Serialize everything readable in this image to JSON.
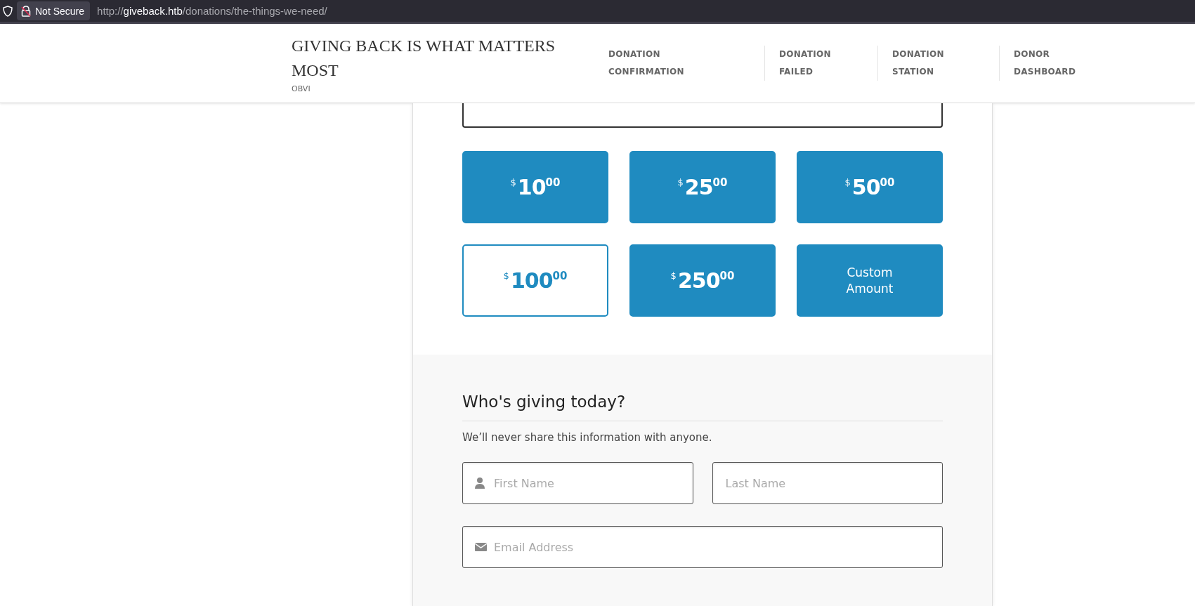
{
  "browser": {
    "security": "Not Secure",
    "url": {
      "scheme": "http://",
      "host": "giveback.htb",
      "path": "/donations/the-things-we-need/"
    }
  },
  "header": {
    "title": "GIVING BACK IS WHAT MATTERS MOST",
    "tagline": "OBVI",
    "nav": [
      {
        "label": "DONATION CONFIRMATION"
      },
      {
        "label": "DONATION FAILED"
      },
      {
        "label": "DONATION STATION"
      },
      {
        "label": "DONOR DASHBOARD"
      }
    ]
  },
  "amounts": [
    {
      "kind": "preset",
      "currency": "$",
      "whole": "10",
      "cents": "00",
      "selected": false
    },
    {
      "kind": "preset",
      "currency": "$",
      "whole": "25",
      "cents": "00",
      "selected": false
    },
    {
      "kind": "preset",
      "currency": "$",
      "whole": "50",
      "cents": "00",
      "selected": false
    },
    {
      "kind": "preset",
      "currency": "$",
      "whole": "100",
      "cents": "00",
      "selected": true
    },
    {
      "kind": "preset",
      "currency": "$",
      "whole": "250",
      "cents": "00",
      "selected": false
    },
    {
      "kind": "custom",
      "label": "Custom Amount",
      "selected": false
    }
  ],
  "donor": {
    "heading": "Who's giving today?",
    "note": "We’ll never share this information with anyone.",
    "fields": [
      {
        "kind": "first",
        "placeholder": "First Name"
      },
      {
        "kind": "last",
        "placeholder": "Last Name"
      },
      {
        "kind": "email",
        "placeholder": "Email Address"
      }
    ]
  }
}
